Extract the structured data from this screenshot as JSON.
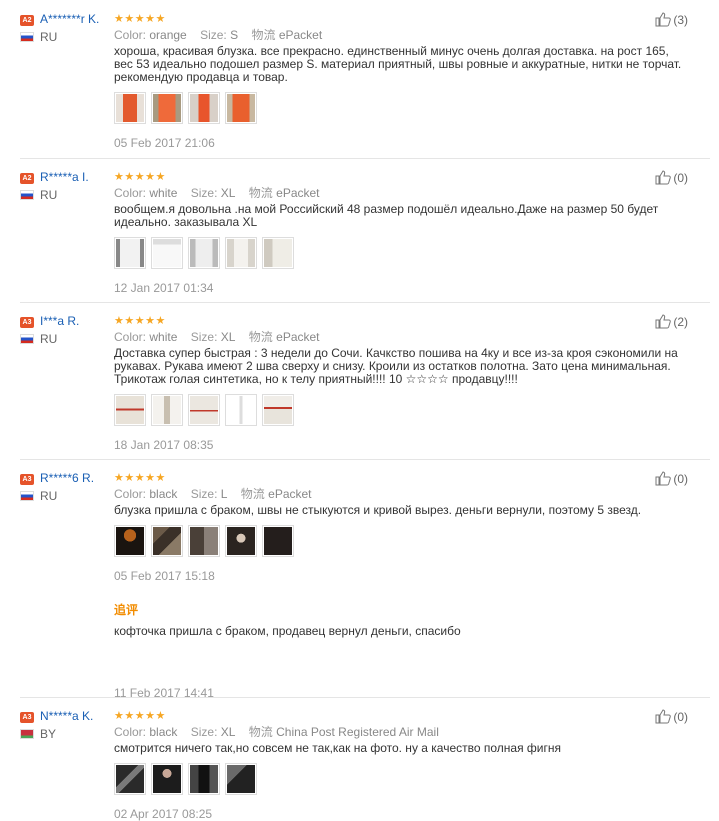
{
  "labels": {
    "color": "Color:",
    "size": "Size:",
    "shipping": "物流"
  },
  "reviews": [
    {
      "level": "A2",
      "name": "A*******r K.",
      "country": "RU",
      "color": "orange",
      "size": "S",
      "shipping": "ePacket",
      "text": "хороша, красивая блузка. все прекрасно. единственный минус очень долгая доставка. на рост 165, вес 53 идеально подошел размер S. материал приятный, швы ровные и аккуратные, нитки не торчат. рекомендую продавца и товар.",
      "date": "05 Feb 2017 21:06",
      "helpful": "(3)"
    },
    {
      "level": "A2",
      "name": "R*****a I.",
      "country": "RU",
      "color": "white",
      "size": "XL",
      "shipping": "ePacket",
      "text": "вообщем.я довольна .на мой Российский 48 размер подошёл идеально.Даже на размер 50 будет идеально. заказывала XL",
      "date": "12 Jan 2017 01:34",
      "helpful": "(0)"
    },
    {
      "level": "A3",
      "name": "I***a R.",
      "country": "RU",
      "color": "white",
      "size": "XL",
      "shipping": "ePacket",
      "text": "Доставка супер быстрая : 3 недели до Сочи. Качкство пошива на 4ку и все из-за кроя сэкономили на рукавах. Рукава имеют 2 шва сверху и снизу. Кроили из остатков полотна. Зато цена минимальная. Трикотаж голая синтетика, но к телу приятный!!!! 10 ☆☆☆☆ продавцу!!!!",
      "date": "18 Jan 2017 08:35",
      "helpful": "(2)"
    },
    {
      "level": "A3",
      "name": "R*****6 R.",
      "country": "RU",
      "color": "black",
      "size": "L",
      "shipping": "ePacket",
      "text": "блузка пришла с браком, швы не стыкуются и кривой вырез. деньги вернули, поэтому 5 звезд.",
      "date": "05 Feb 2017 15:18",
      "helpful": "(0)",
      "additional_label": "追评",
      "additional_text": "кофточка пришла с браком, продавец вернул деньги, спасибо",
      "additional_date": "11 Feb 2017 14:41"
    },
    {
      "level": "A3",
      "name": "N*****a K.",
      "country": "BY",
      "color": "black",
      "size": "XL",
      "shipping": "China Post Registered Air Mail",
      "text": "смотрится ничего так,но совсем не так,как на фото. ну а качество полная фигня",
      "date": "02 Apr 2017 08:25",
      "helpful": "(0)"
    }
  ],
  "colors": {
    "star": "#f6a623",
    "badge": "#e5532a",
    "username": "#1a5fb4",
    "additional": "#f28c00"
  }
}
